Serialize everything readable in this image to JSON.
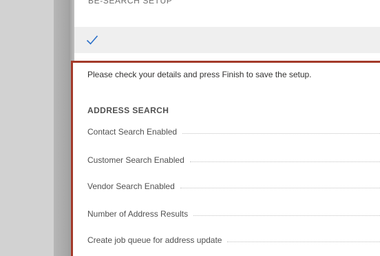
{
  "dialog": {
    "title": "BE-SEARCH SETUP",
    "intro": "Please check your details and press Finish to save the setup.",
    "section": {
      "heading": "ADDRESS SEARCH",
      "fields": [
        {
          "label": "Contact Search Enabled"
        },
        {
          "label": "Customer Search Enabled"
        },
        {
          "label": "Vendor Search Enabled"
        },
        {
          "label": "Number of Address Results"
        },
        {
          "label": "Create job queue for address update"
        }
      ]
    }
  },
  "icons": {
    "step_complete": "checkmark-icon"
  },
  "colors": {
    "highlight_border": "#a33a2a",
    "check_accent": "#2a6fc9"
  }
}
